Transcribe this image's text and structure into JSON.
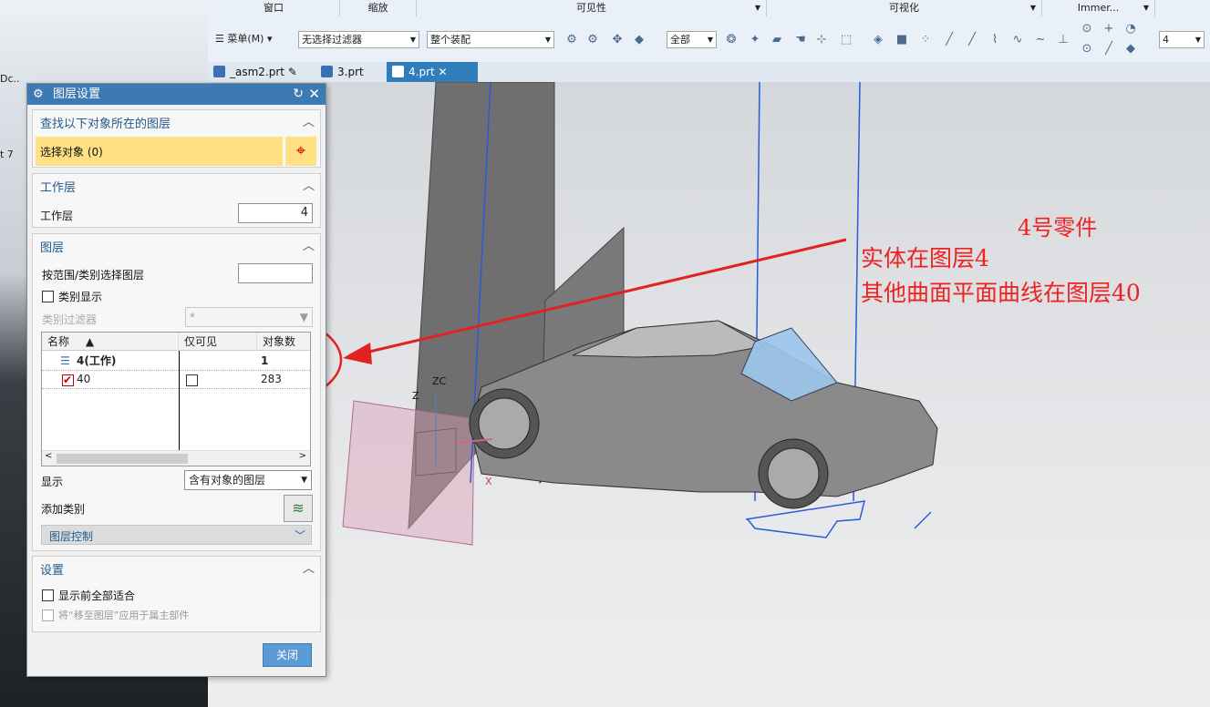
{
  "desktop_fragments": [
    "Dc..",
    "t 7"
  ],
  "toolbar": {
    "groups": [
      "窗口",
      "缩放",
      "可见性",
      "可视化",
      "Immer..."
    ],
    "menu_label": "菜单(M)",
    "filter_select": "无选择过滤器",
    "assembly_select": "整个装配",
    "scope_select": "全部",
    "layer_select": "4"
  },
  "tabs": [
    "_asm2.prt",
    "3.prt",
    "4.prt"
  ],
  "dialog": {
    "title": "图层设置",
    "find_section": {
      "title": "查找以下对象所在的图层",
      "select_label": "选择对象 (0)"
    },
    "work_layer_section": {
      "title": "工作层",
      "label": "工作层",
      "value": "4"
    },
    "layer_section": {
      "title": "图层",
      "range_label": "按范围/类别选择图层",
      "category_display_label": "类别显示",
      "category_filter_label": "类别过滤器",
      "category_filter_value": "*",
      "columns": [
        "名称",
        "仅可见",
        "对象数"
      ],
      "rows": [
        {
          "name": "4(工作)",
          "visible_only": "",
          "count": "1"
        },
        {
          "name": "40",
          "visible_only": "",
          "count": "283"
        }
      ],
      "display_label": "显示",
      "display_value": "含有对象的图层",
      "add_category_label": "添加类别",
      "layer_control_label": "图层控制"
    },
    "settings_section": {
      "title": "设置",
      "fit_all_label": "显示前全部适合",
      "move_label": "将“移至图层”应用于属主部件"
    },
    "close_label": "关闭"
  },
  "annotations": {
    "line1": "4号零件",
    "line2": "实体在图层4",
    "line3": "其他曲面平面曲线在图层40"
  },
  "viewport_labels": {
    "zc": "ZC",
    "x": "X",
    "z": "Z"
  },
  "colors": {
    "accent": "#3d7ab3",
    "highlight": "#ffe082",
    "annotation": "#e22222"
  }
}
